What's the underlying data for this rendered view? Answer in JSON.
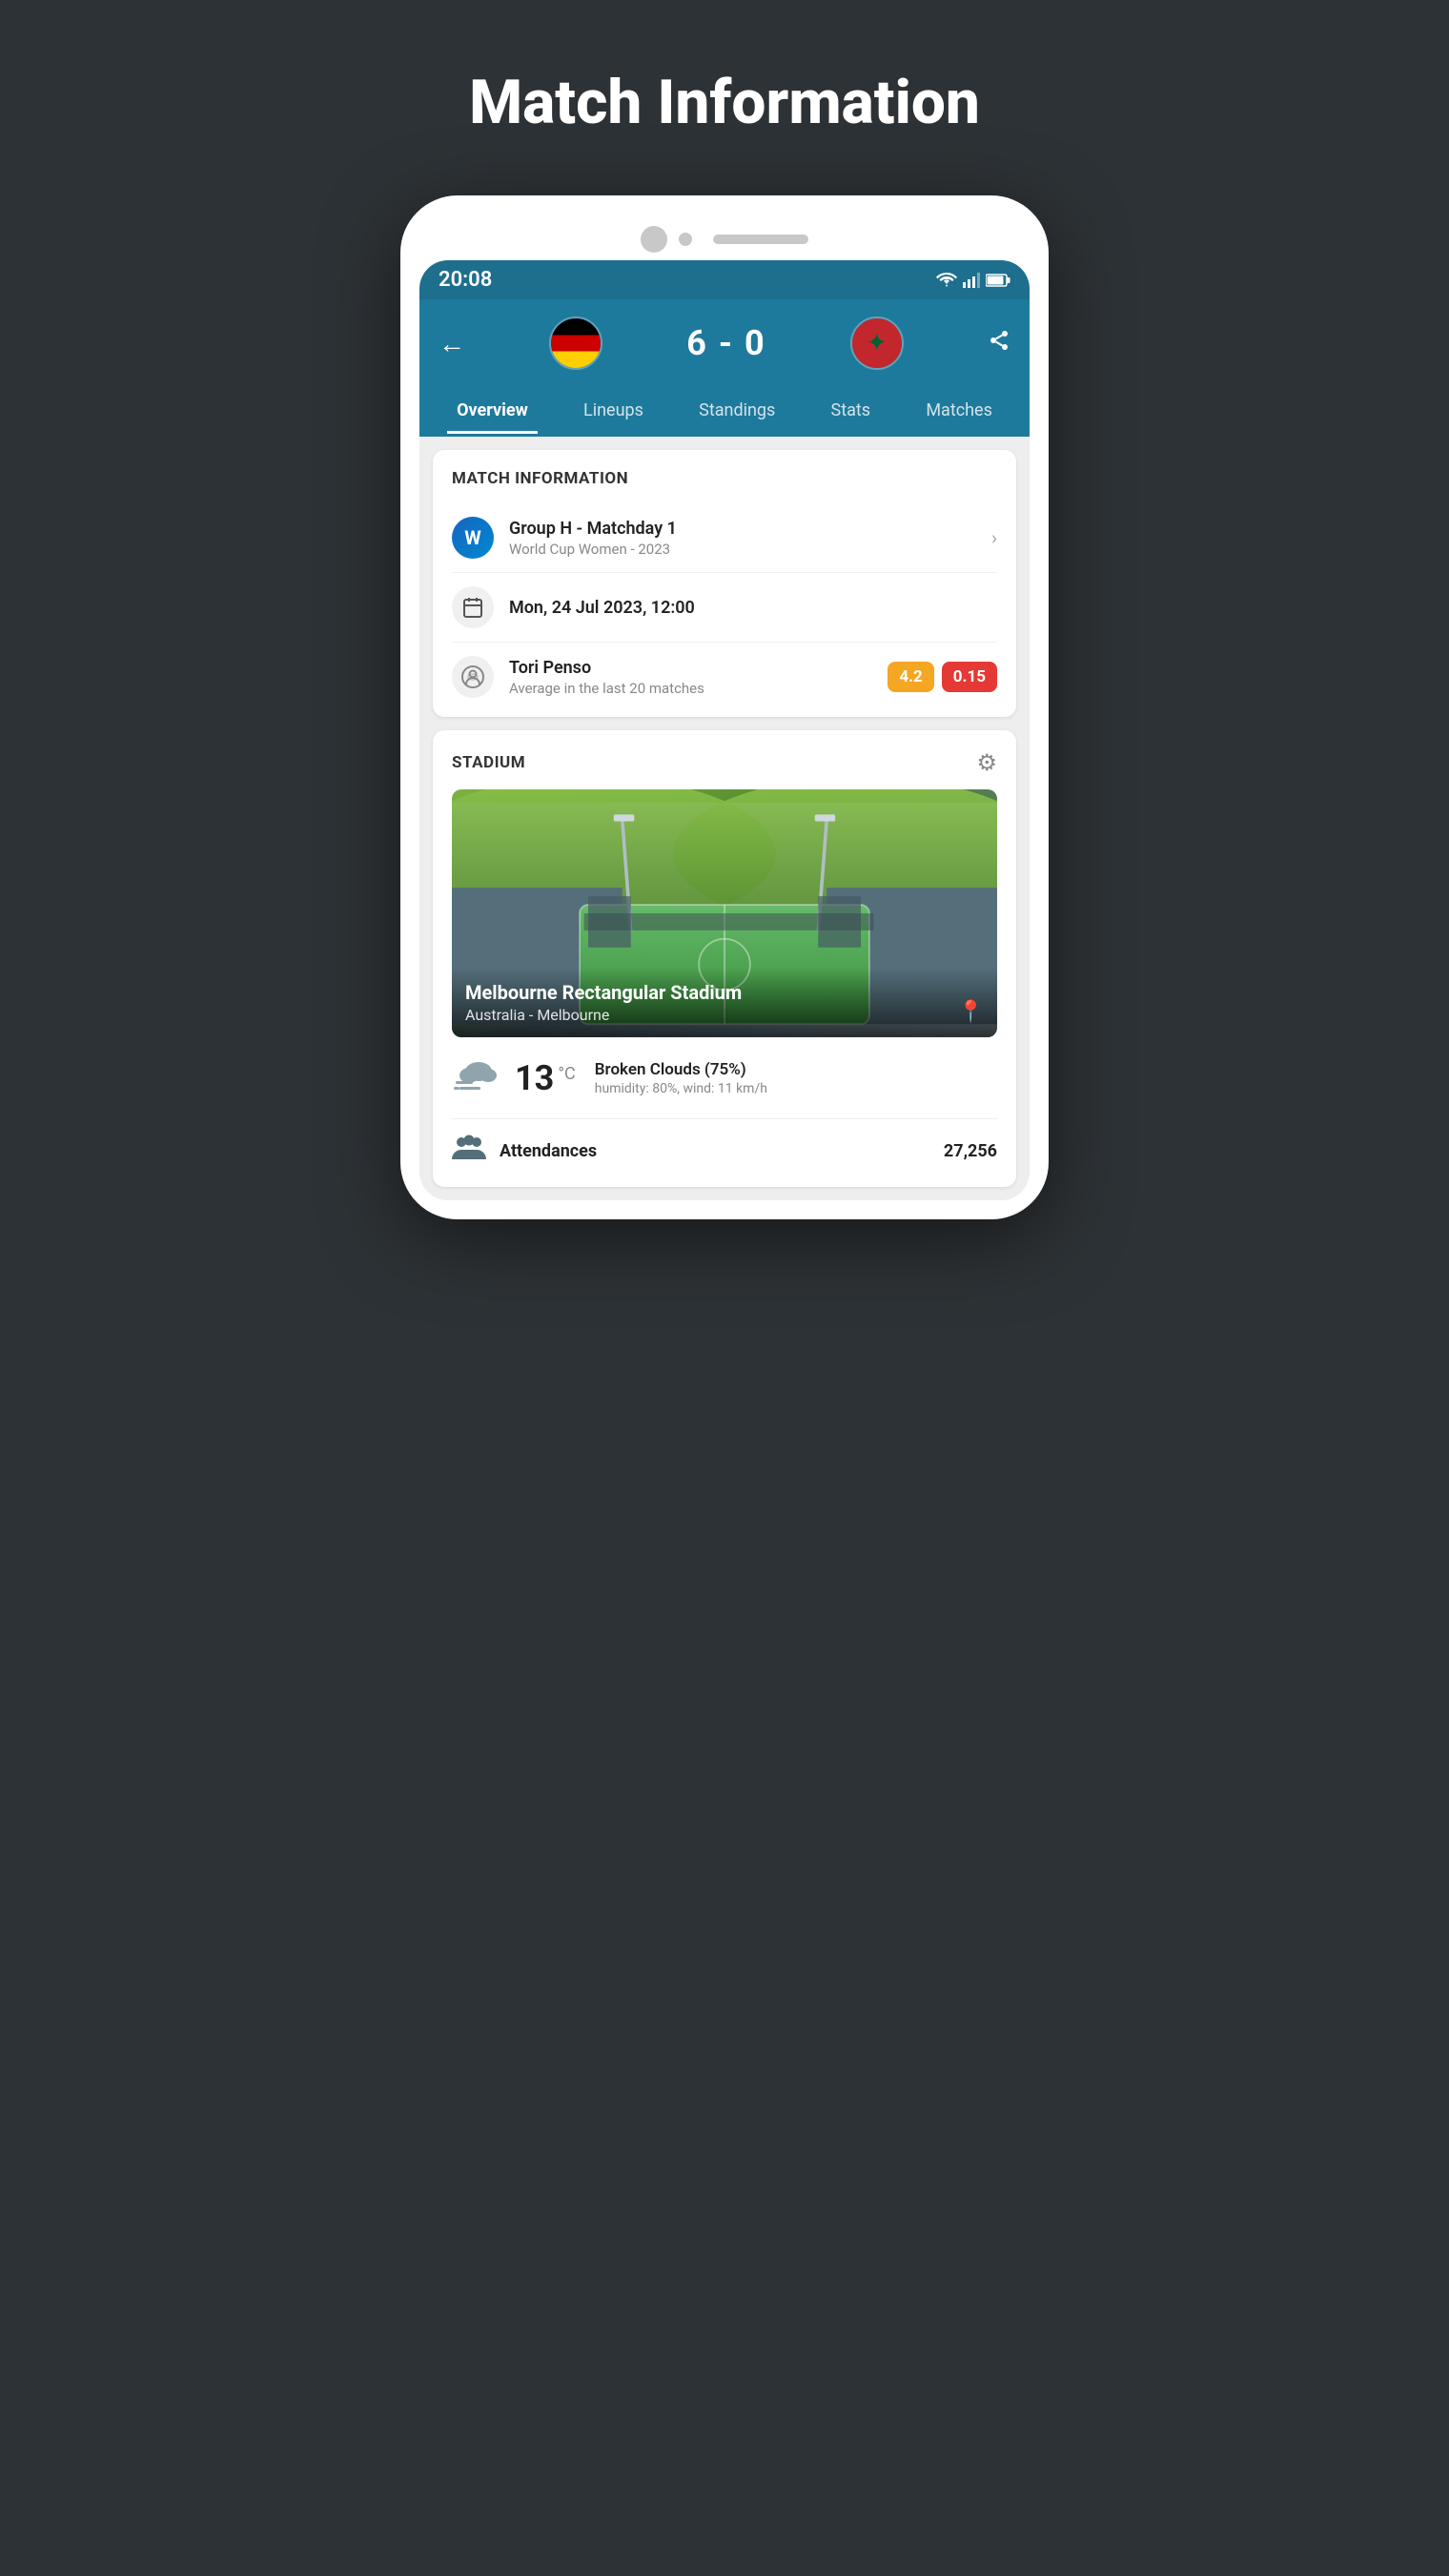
{
  "page": {
    "title": "Match Information"
  },
  "status_bar": {
    "time": "20:08"
  },
  "header": {
    "back_label": "←",
    "score": "6 - 0",
    "share_label": "⋗"
  },
  "tabs": [
    {
      "id": "overview",
      "label": "Overview",
      "active": true
    },
    {
      "id": "lineups",
      "label": "Lineups",
      "active": false
    },
    {
      "id": "standings",
      "label": "Standings",
      "active": false
    },
    {
      "id": "stats",
      "label": "Stats",
      "active": false
    },
    {
      "id": "matches",
      "label": "Matches",
      "active": false
    }
  ],
  "match_info": {
    "section_title": "MATCH INFORMATION",
    "competition": {
      "name": "Group H - Matchday 1",
      "sub": "World Cup Women - 2023"
    },
    "date": {
      "value": "Mon, 24 Jul 2023, 12:00"
    },
    "referee": {
      "name": "Tori Penso",
      "sub": "Average in the last 20 matches",
      "badge1": "4.2",
      "badge2": "0.15"
    }
  },
  "stadium": {
    "section_title": "STADIUM",
    "name": "Melbourne Rectangular Stadium",
    "location": "Australia - Melbourne"
  },
  "weather": {
    "temperature": "13",
    "unit": "°C",
    "condition": "Broken Clouds (75%)",
    "details": "humidity: 80%, wind: 11 km/h"
  },
  "attendance": {
    "label": "Attendances",
    "value": "27,256"
  }
}
